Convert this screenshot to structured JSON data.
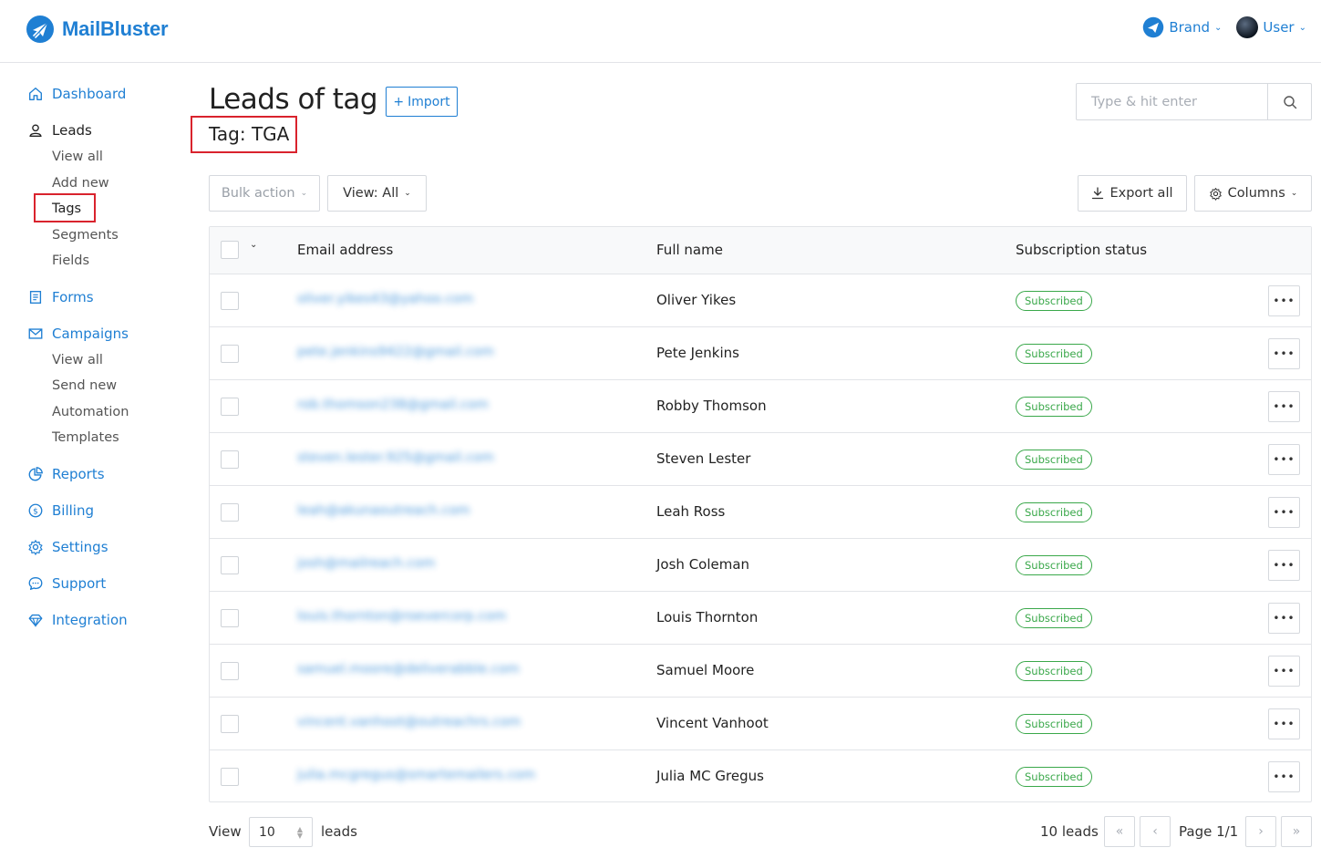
{
  "header": {
    "logo_text": "MailBluster",
    "brand_label": "Brand",
    "user_label": "User",
    "colors": {
      "accent": "#1f7fd3",
      "success": "#3aa84a",
      "highlight": "#d9232d"
    }
  },
  "sidebar": {
    "dashboard": "Dashboard",
    "leads": "Leads",
    "leads_sub": [
      "View all",
      "Add new",
      "Tags",
      "Segments",
      "Fields"
    ],
    "forms": "Forms",
    "campaigns": "Campaigns",
    "campaigns_sub": [
      "View all",
      "Send new",
      "Automation",
      "Templates"
    ],
    "reports": "Reports",
    "billing": "Billing",
    "settings": "Settings",
    "support": "Support",
    "integration": "Integration"
  },
  "main": {
    "title": "Leads of tag",
    "import_label": "Import",
    "tag_line": "Tag: TGA",
    "search_placeholder": "Type & hit enter",
    "bulk_action": "Bulk action",
    "view_filter": "View: All",
    "export_all": "Export all",
    "columns": "Columns"
  },
  "table": {
    "headers": {
      "email": "Email address",
      "name": "Full name",
      "status": "Subscription status"
    },
    "rows": [
      {
        "email": "oliver.yikes43@yahoo.com",
        "name": "Oliver Yikes",
        "status": "Subscribed"
      },
      {
        "email": "pete.jenkins9422@gmail.com",
        "name": "Pete Jenkins",
        "status": "Subscribed"
      },
      {
        "email": "rob.thomson238@gmail.com",
        "name": "Robby Thomson",
        "status": "Subscribed"
      },
      {
        "email": "steven.lester.925@gmail.com",
        "name": "Steven Lester",
        "status": "Subscribed"
      },
      {
        "email": "leah@akunaoutreach.com",
        "name": "Leah Ross",
        "status": "Subscribed"
      },
      {
        "email": "josh@mailreach.com",
        "name": "Josh Coleman",
        "status": "Subscribed"
      },
      {
        "email": "louis.thornton@roevercorp.com",
        "name": "Louis Thornton",
        "status": "Subscribed"
      },
      {
        "email": "samuel.moore@deliverabble.com",
        "name": "Samuel Moore",
        "status": "Subscribed"
      },
      {
        "email": "vincent.vanhoot@outreachrs.com",
        "name": "Vincent Vanhoot",
        "status": "Subscribed"
      },
      {
        "email": "julia.mcgregus@smartemailers.com",
        "name": "Julia MC Gregus",
        "status": "Subscribed"
      }
    ]
  },
  "footer": {
    "view_label": "View",
    "per_page": "10",
    "leads_label": "leads",
    "count": "10 leads",
    "page": "Page 1/1"
  }
}
